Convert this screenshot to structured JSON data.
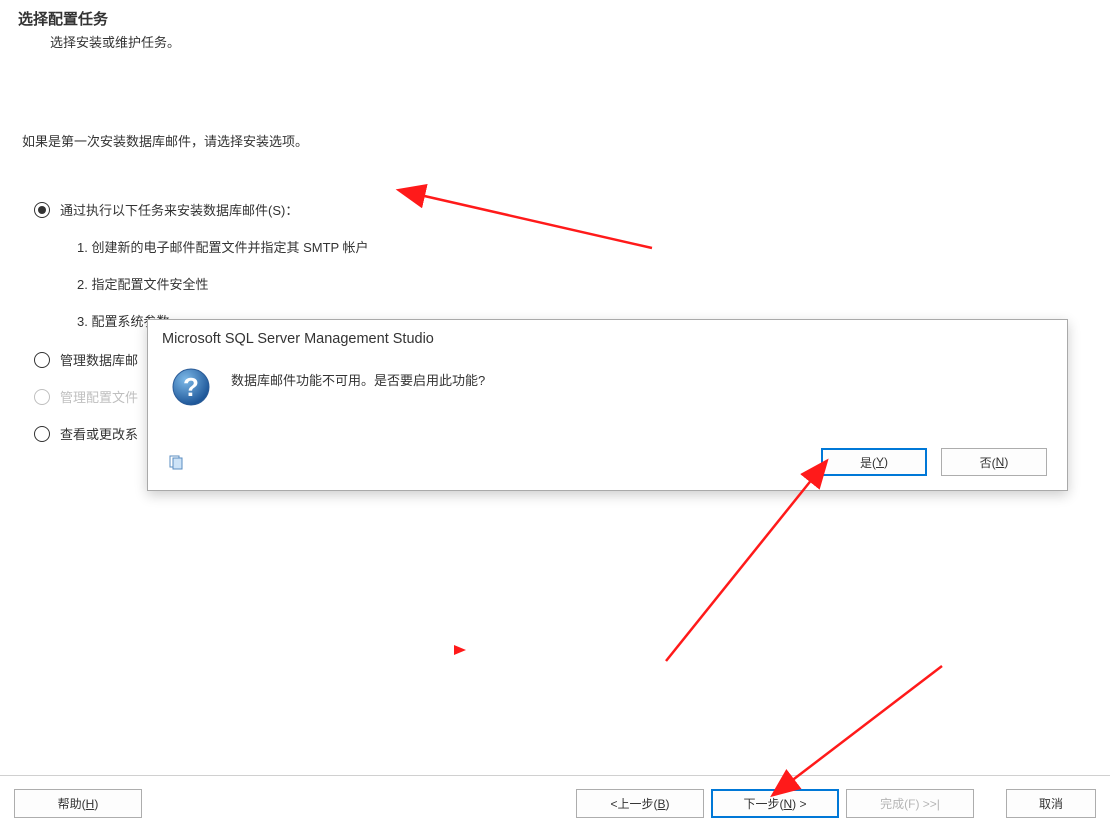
{
  "header": {
    "title": "选择配置任务",
    "subtitle": "选择安装或维护任务。"
  },
  "intro": "如果是第一次安装数据库邮件，请选择安装选项。",
  "options": {
    "opt1": {
      "label": "通过执行以下任务来安装数据库邮件(S)：",
      "sub1": "1.  创建新的电子邮件配置文件并指定其 SMTP 帐户",
      "sub2": "2.  指定配置文件安全性",
      "sub3": "3.  配置系统参数"
    },
    "opt2": {
      "label": "管理数据库邮"
    },
    "opt3": {
      "label": "管理配置文件"
    },
    "opt4": {
      "label": "查看或更改系"
    }
  },
  "dialog": {
    "title": "Microsoft SQL Server Management Studio",
    "message": "数据库邮件功能不可用。是否要启用此功能?",
    "yes_prefix": "是(",
    "yes_key": "Y",
    "yes_suffix": ")",
    "no_prefix": "否(",
    "no_key": "N",
    "no_suffix": ")"
  },
  "footer": {
    "help_prefix": "帮助(",
    "help_key": "H",
    "help_suffix": ")",
    "back_arrow": "< ",
    "back_prefix": "上一步(",
    "back_key": "B",
    "back_suffix": ")",
    "next_prefix": "下一步(",
    "next_key": "N",
    "next_suffix": ") >",
    "finish_prefix": "完成(",
    "finish_key": "F",
    "finish_suffix": ") >>|",
    "cancel": "取消"
  }
}
